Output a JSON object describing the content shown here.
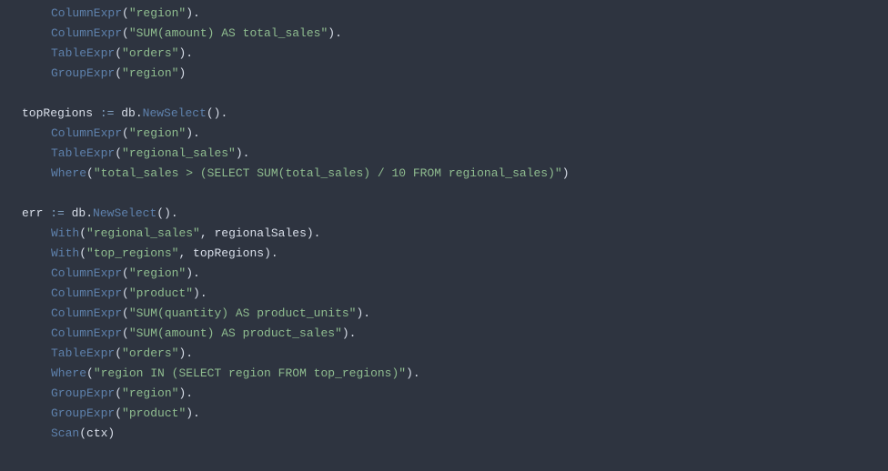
{
  "code": {
    "lines": [
      {
        "indent": 1,
        "tokens": [
          {
            "type": "method",
            "text": "ColumnExpr"
          },
          {
            "type": "punct",
            "text": "("
          },
          {
            "type": "string",
            "text": "\"region\""
          },
          {
            "type": "punct",
            "text": ")."
          }
        ]
      },
      {
        "indent": 1,
        "tokens": [
          {
            "type": "method",
            "text": "ColumnExpr"
          },
          {
            "type": "punct",
            "text": "("
          },
          {
            "type": "string",
            "text": "\"SUM(amount) AS total_sales\""
          },
          {
            "type": "punct",
            "text": ")."
          }
        ]
      },
      {
        "indent": 1,
        "tokens": [
          {
            "type": "method",
            "text": "TableExpr"
          },
          {
            "type": "punct",
            "text": "("
          },
          {
            "type": "string",
            "text": "\"orders\""
          },
          {
            "type": "punct",
            "text": ")."
          }
        ]
      },
      {
        "indent": 1,
        "tokens": [
          {
            "type": "method",
            "text": "GroupExpr"
          },
          {
            "type": "punct",
            "text": "("
          },
          {
            "type": "string",
            "text": "\"region\""
          },
          {
            "type": "punct",
            "text": ")"
          }
        ]
      },
      {
        "blank": true
      },
      {
        "indent": 0,
        "tokens": [
          {
            "type": "ident",
            "text": "topRegions "
          },
          {
            "type": "op",
            "text": ":="
          },
          {
            "type": "ident",
            "text": " db."
          },
          {
            "type": "method",
            "text": "NewSelect"
          },
          {
            "type": "punct",
            "text": "()."
          }
        ]
      },
      {
        "indent": 1,
        "tokens": [
          {
            "type": "method",
            "text": "ColumnExpr"
          },
          {
            "type": "punct",
            "text": "("
          },
          {
            "type": "string",
            "text": "\"region\""
          },
          {
            "type": "punct",
            "text": ")."
          }
        ]
      },
      {
        "indent": 1,
        "tokens": [
          {
            "type": "method",
            "text": "TableExpr"
          },
          {
            "type": "punct",
            "text": "("
          },
          {
            "type": "string",
            "text": "\"regional_sales\""
          },
          {
            "type": "punct",
            "text": ")."
          }
        ]
      },
      {
        "indent": 1,
        "tokens": [
          {
            "type": "method",
            "text": "Where"
          },
          {
            "type": "punct",
            "text": "("
          },
          {
            "type": "string",
            "text": "\"total_sales > (SELECT SUM(total_sales) / 10 FROM regional_sales)\""
          },
          {
            "type": "punct",
            "text": ")"
          }
        ]
      },
      {
        "blank": true
      },
      {
        "indent": 0,
        "tokens": [
          {
            "type": "ident",
            "text": "err "
          },
          {
            "type": "op",
            "text": ":="
          },
          {
            "type": "ident",
            "text": " db."
          },
          {
            "type": "method",
            "text": "NewSelect"
          },
          {
            "type": "punct",
            "text": "()."
          }
        ]
      },
      {
        "indent": 1,
        "tokens": [
          {
            "type": "method",
            "text": "With"
          },
          {
            "type": "punct",
            "text": "("
          },
          {
            "type": "string",
            "text": "\"regional_sales\""
          },
          {
            "type": "punct",
            "text": ", regionalSales)."
          }
        ]
      },
      {
        "indent": 1,
        "tokens": [
          {
            "type": "method",
            "text": "With"
          },
          {
            "type": "punct",
            "text": "("
          },
          {
            "type": "string",
            "text": "\"top_regions\""
          },
          {
            "type": "punct",
            "text": ", topRegions)."
          }
        ]
      },
      {
        "indent": 1,
        "tokens": [
          {
            "type": "method",
            "text": "ColumnExpr"
          },
          {
            "type": "punct",
            "text": "("
          },
          {
            "type": "string",
            "text": "\"region\""
          },
          {
            "type": "punct",
            "text": ")."
          }
        ]
      },
      {
        "indent": 1,
        "tokens": [
          {
            "type": "method",
            "text": "ColumnExpr"
          },
          {
            "type": "punct",
            "text": "("
          },
          {
            "type": "string",
            "text": "\"product\""
          },
          {
            "type": "punct",
            "text": ")."
          }
        ]
      },
      {
        "indent": 1,
        "tokens": [
          {
            "type": "method",
            "text": "ColumnExpr"
          },
          {
            "type": "punct",
            "text": "("
          },
          {
            "type": "string",
            "text": "\"SUM(quantity) AS product_units\""
          },
          {
            "type": "punct",
            "text": ")."
          }
        ]
      },
      {
        "indent": 1,
        "tokens": [
          {
            "type": "method",
            "text": "ColumnExpr"
          },
          {
            "type": "punct",
            "text": "("
          },
          {
            "type": "string",
            "text": "\"SUM(amount) AS product_sales\""
          },
          {
            "type": "punct",
            "text": ")."
          }
        ]
      },
      {
        "indent": 1,
        "tokens": [
          {
            "type": "method",
            "text": "TableExpr"
          },
          {
            "type": "punct",
            "text": "("
          },
          {
            "type": "string",
            "text": "\"orders\""
          },
          {
            "type": "punct",
            "text": ")."
          }
        ]
      },
      {
        "indent": 1,
        "tokens": [
          {
            "type": "method",
            "text": "Where"
          },
          {
            "type": "punct",
            "text": "("
          },
          {
            "type": "string",
            "text": "\"region IN (SELECT region FROM top_regions)\""
          },
          {
            "type": "punct",
            "text": ")."
          }
        ]
      },
      {
        "indent": 1,
        "tokens": [
          {
            "type": "method",
            "text": "GroupExpr"
          },
          {
            "type": "punct",
            "text": "("
          },
          {
            "type": "string",
            "text": "\"region\""
          },
          {
            "type": "punct",
            "text": ")."
          }
        ]
      },
      {
        "indent": 1,
        "tokens": [
          {
            "type": "method",
            "text": "GroupExpr"
          },
          {
            "type": "punct",
            "text": "("
          },
          {
            "type": "string",
            "text": "\"product\""
          },
          {
            "type": "punct",
            "text": ")."
          }
        ]
      },
      {
        "indent": 1,
        "tokens": [
          {
            "type": "method",
            "text": "Scan"
          },
          {
            "type": "punct",
            "text": "(ctx)"
          }
        ]
      }
    ]
  }
}
